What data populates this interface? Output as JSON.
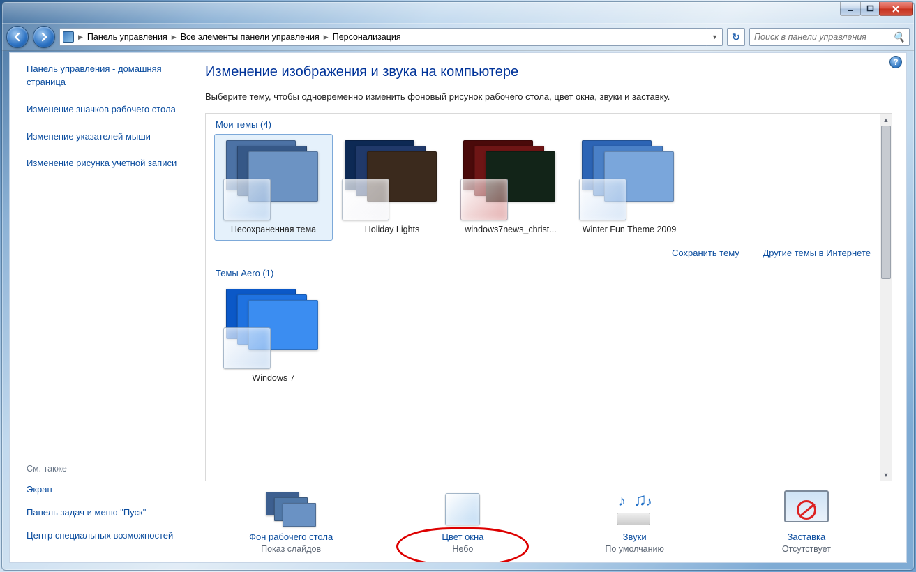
{
  "breadcrumb": {
    "seg1": "Панель управления",
    "seg2": "Все элементы панели управления",
    "seg3": "Персонализация"
  },
  "search": {
    "placeholder": "Поиск в панели управления"
  },
  "sidebar": {
    "home": "Панель управления - домашняя страница",
    "links": [
      "Изменение значков рабочего стола",
      "Изменение указателей мыши",
      "Изменение рисунка учетной записи"
    ],
    "see_also_label": "См. также",
    "see_also": [
      "Экран",
      "Панель задач и меню \"Пуск\"",
      "Центр специальных возможностей"
    ]
  },
  "main": {
    "title": "Изменение изображения и звука на компьютере",
    "desc": "Выберите тему, чтобы одновременно изменить фоновый рисунок рабочего стола, цвет окна, звуки и заставку.",
    "group_my_themes": "Мои темы (4)",
    "group_aero": "Темы Aero (1)",
    "themes_my": [
      {
        "name": "Несохраненная тема",
        "c1": "#4c72a5",
        "c2": "#365887",
        "c3": "#6c93c3",
        "gl": "rgba(170,200,235,.55)"
      },
      {
        "name": "Holiday Lights",
        "c1": "#0d2954",
        "c2": "#20396a",
        "c3": "#3b2a1d",
        "gl": "rgba(240,240,245,.6)"
      },
      {
        "name": "windows7news_christ...",
        "c1": "#4a0a0a",
        "c2": "#6e1515",
        "c3": "#122418",
        "gl": "rgba(205,110,110,.55)"
      },
      {
        "name": "Winter Fun Theme 2009",
        "c1": "#2c64b5",
        "c2": "#4a80c7",
        "c3": "#7aa6db",
        "gl": "rgba(185,210,240,.55)"
      }
    ],
    "themes_aero": [
      {
        "name": "Windows 7",
        "c1": "#0b58c7",
        "c2": "#1f72e0",
        "c3": "#3b8df1",
        "gl": "rgba(170,200,235,.55)"
      }
    ],
    "save_theme": "Сохранить тему",
    "more_online": "Другие темы в Интернете"
  },
  "bottom": {
    "wall_label": "Фон рабочего стола",
    "wall_sub": "Показ слайдов",
    "color_label": "Цвет окна",
    "color_sub": "Небо",
    "sounds_label": "Звуки",
    "sounds_sub": "По умолчанию",
    "saver_label": "Заставка",
    "saver_sub": "Отсутствует"
  }
}
